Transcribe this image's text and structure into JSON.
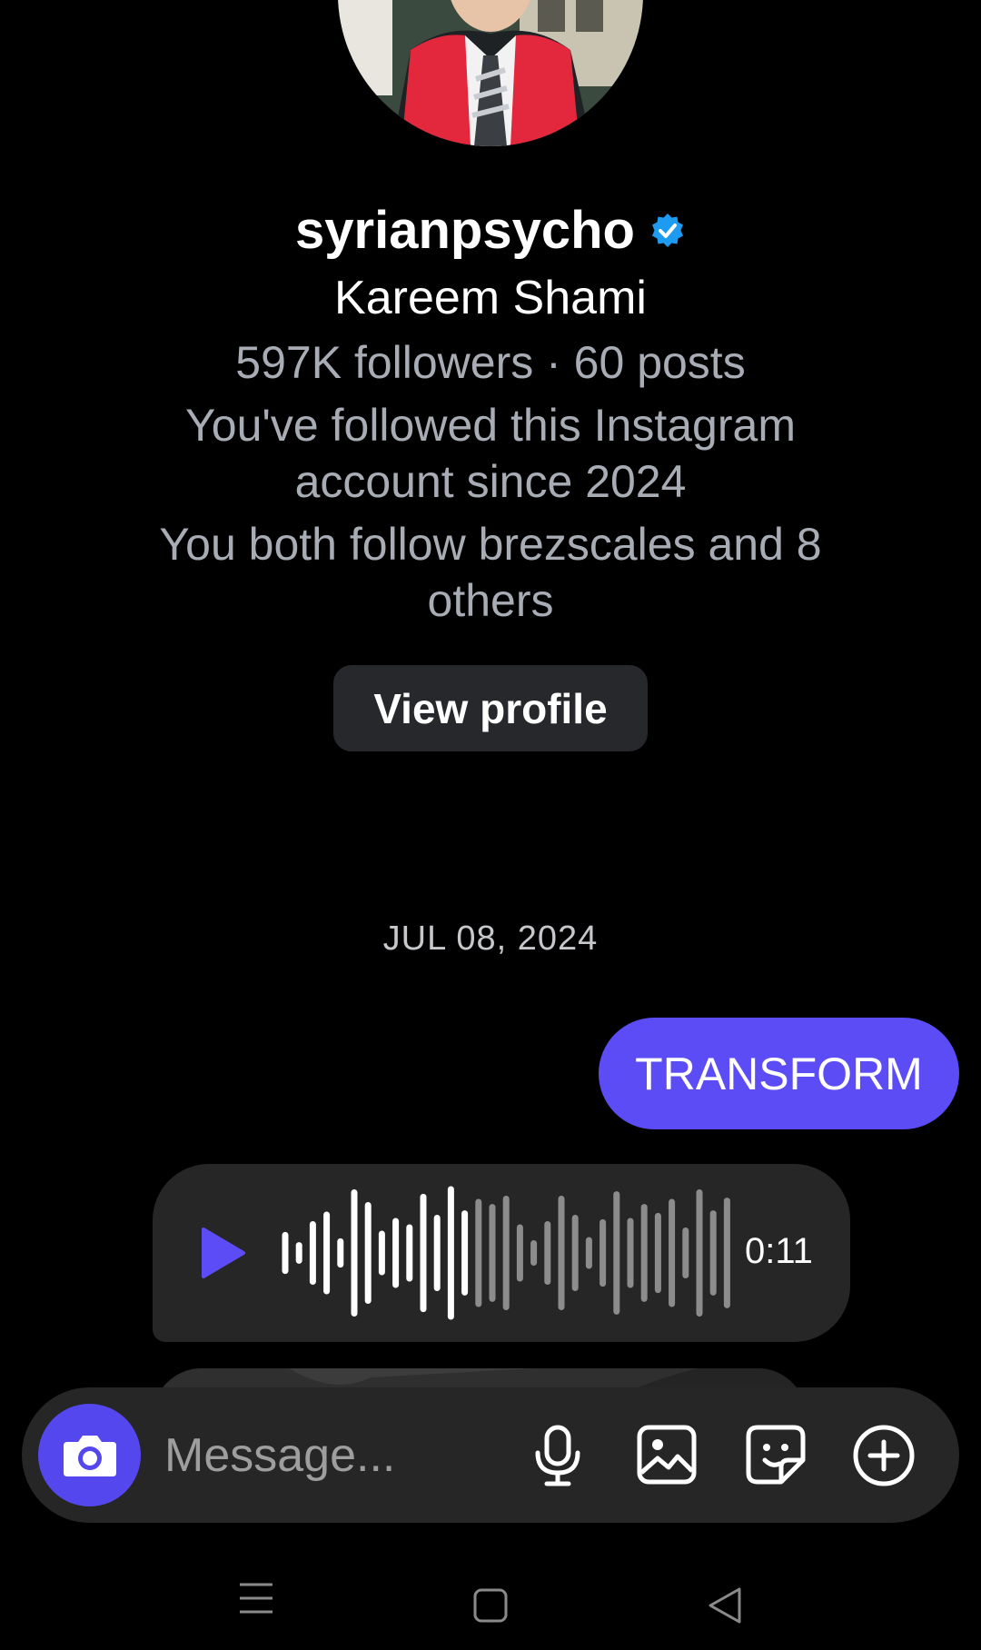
{
  "profile": {
    "username": "syrianpsycho",
    "full_name": "Kareem Shami",
    "stats": "597K followers · 60 posts",
    "follow_since_line1": "You've followed this Instagram",
    "follow_since_line2": "account since 2024",
    "mutual_line1": "You both follow brezscales and 8",
    "mutual_line2": "others",
    "view_profile_label": "View profile"
  },
  "thread": {
    "date": "JUL 08, 2024",
    "sent_message": "TRANSFORM",
    "voice_message": {
      "duration": "0:11",
      "played_fraction": 0.42
    }
  },
  "composer": {
    "placeholder": "Message..."
  },
  "colors": {
    "accent": "#5b4cf5",
    "verified": "#1d9bf0",
    "muted_text": "#a8acb4"
  },
  "icons": [
    "camera-icon",
    "microphone-icon",
    "gallery-icon",
    "sticker-icon",
    "plus-circle-icon",
    "menu-icon",
    "home-square-icon",
    "back-triangle-icon"
  ]
}
